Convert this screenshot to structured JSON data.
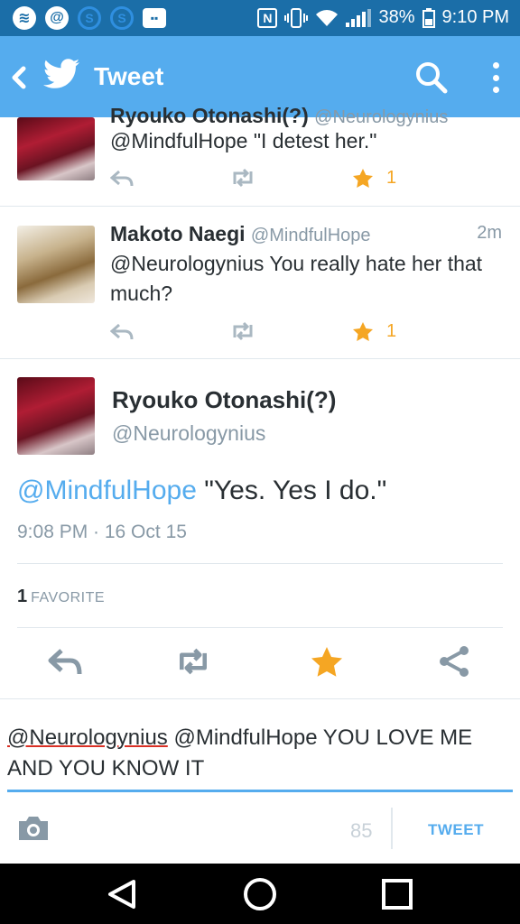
{
  "status_bar": {
    "left_icons": [
      "spotify-icon",
      "at-icon",
      "s-app-icon",
      "s-app-icon",
      "messenger-icon"
    ],
    "nfc": "N",
    "battery": "38%",
    "time": "9:10 PM"
  },
  "app_bar": {
    "title": "Tweet"
  },
  "tweets": [
    {
      "name": "Ryouko Otonashi(?)",
      "handle": "@Neurologynius",
      "text": "@MindfulHope \"I detest her.\"",
      "favorites": "1"
    },
    {
      "name": "Makoto Naegi",
      "handle": "@MindfulHope",
      "time": "2m",
      "text": "@Neurologynius You really hate her that much?",
      "favorites": "1"
    }
  ],
  "focused_tweet": {
    "name": "Ryouko Otonashi(?)",
    "handle": "@Neurologynius",
    "mention": "@MindfulHope",
    "text": " \"Yes. Yes I do.\"",
    "timestamp": "9:08 PM · 16 Oct 15",
    "favorite_count": "1",
    "favorite_label": "FAVORITE"
  },
  "compose": {
    "mention_underlined": "@Neurologynius",
    "text_rest": " @MindfulHope YOU LOVE ME AND YOU KNOW IT",
    "char_count": "85",
    "tweet_button": "TWEET"
  },
  "colors": {
    "twitter_blue": "#55acee",
    "status_bar": "#1b6ea8",
    "favorite_gold": "#f5a623",
    "muted_text": "#8899a6"
  }
}
